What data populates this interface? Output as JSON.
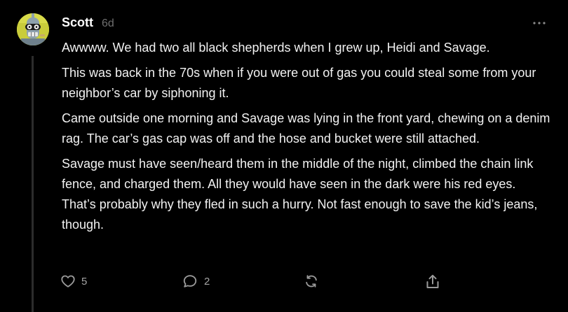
{
  "comment": {
    "author": "Scott",
    "time_ago": "6d",
    "paragraphs": [
      "Awwww. We had two all black shepherds when I grew up, Heidi and Savage.",
      "This was back in the 70s when if you were out of gas you could steal some from your neighbor’s car by siphoning it.",
      "Came outside one morning and Savage was lying in the front yard, chewing on a denim rag. The car’s gas cap was off and the hose and bucket were still attached.",
      "Savage must have seen/heard them in the middle of the night, climbed the chain link fence, and charged them. All they would have seen in the dark were his red eyes. That’s probably why they fled in such a hurry. Not fast enough to save the kid’s jeans, though."
    ],
    "more_icon": "ellipsis-icon"
  },
  "actions": {
    "like": {
      "icon": "heart-icon",
      "count": "5"
    },
    "reply": {
      "icon": "speech-bubble-icon",
      "count": "2"
    },
    "restack": {
      "icon": "refresh-icon"
    },
    "share": {
      "icon": "share-upload-icon"
    }
  },
  "colors": {
    "background": "#000000",
    "text": "#f2f2f2",
    "muted": "#6f6f6f",
    "icon": "#9a9a9a"
  }
}
